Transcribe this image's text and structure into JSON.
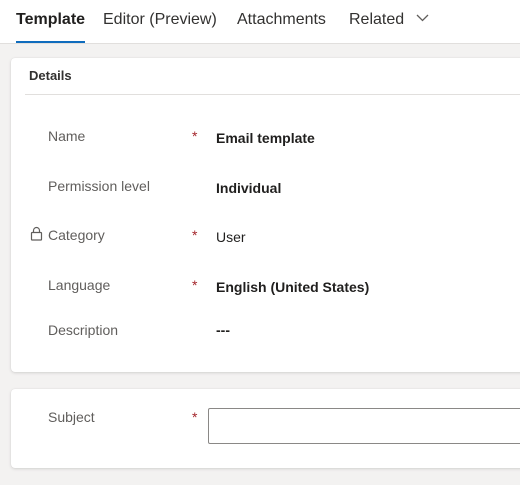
{
  "tabs": [
    {
      "label": "Template",
      "active": true
    },
    {
      "label": "Editor (Preview)",
      "active": false
    },
    {
      "label": "Attachments",
      "active": false
    },
    {
      "label": "Related",
      "active": false
    }
  ],
  "details": {
    "title": "Details",
    "fields": {
      "name": {
        "label": "Name",
        "required": "*",
        "value": "Email template"
      },
      "permission": {
        "label": "Permission level",
        "value": "Individual"
      },
      "category": {
        "label": "Category",
        "required": "*",
        "value": "User",
        "locked_icon": "lock-icon"
      },
      "language": {
        "label": "Language",
        "required": "*",
        "value": "English (United States)"
      },
      "description": {
        "label": "Description",
        "value": "---"
      }
    }
  },
  "subject": {
    "label": "Subject",
    "required": "*",
    "value": ""
  },
  "colors": {
    "accent": "#0f6cbd",
    "required": "#a4262c",
    "label": "#605e5c",
    "background": "#f3f2f1"
  }
}
